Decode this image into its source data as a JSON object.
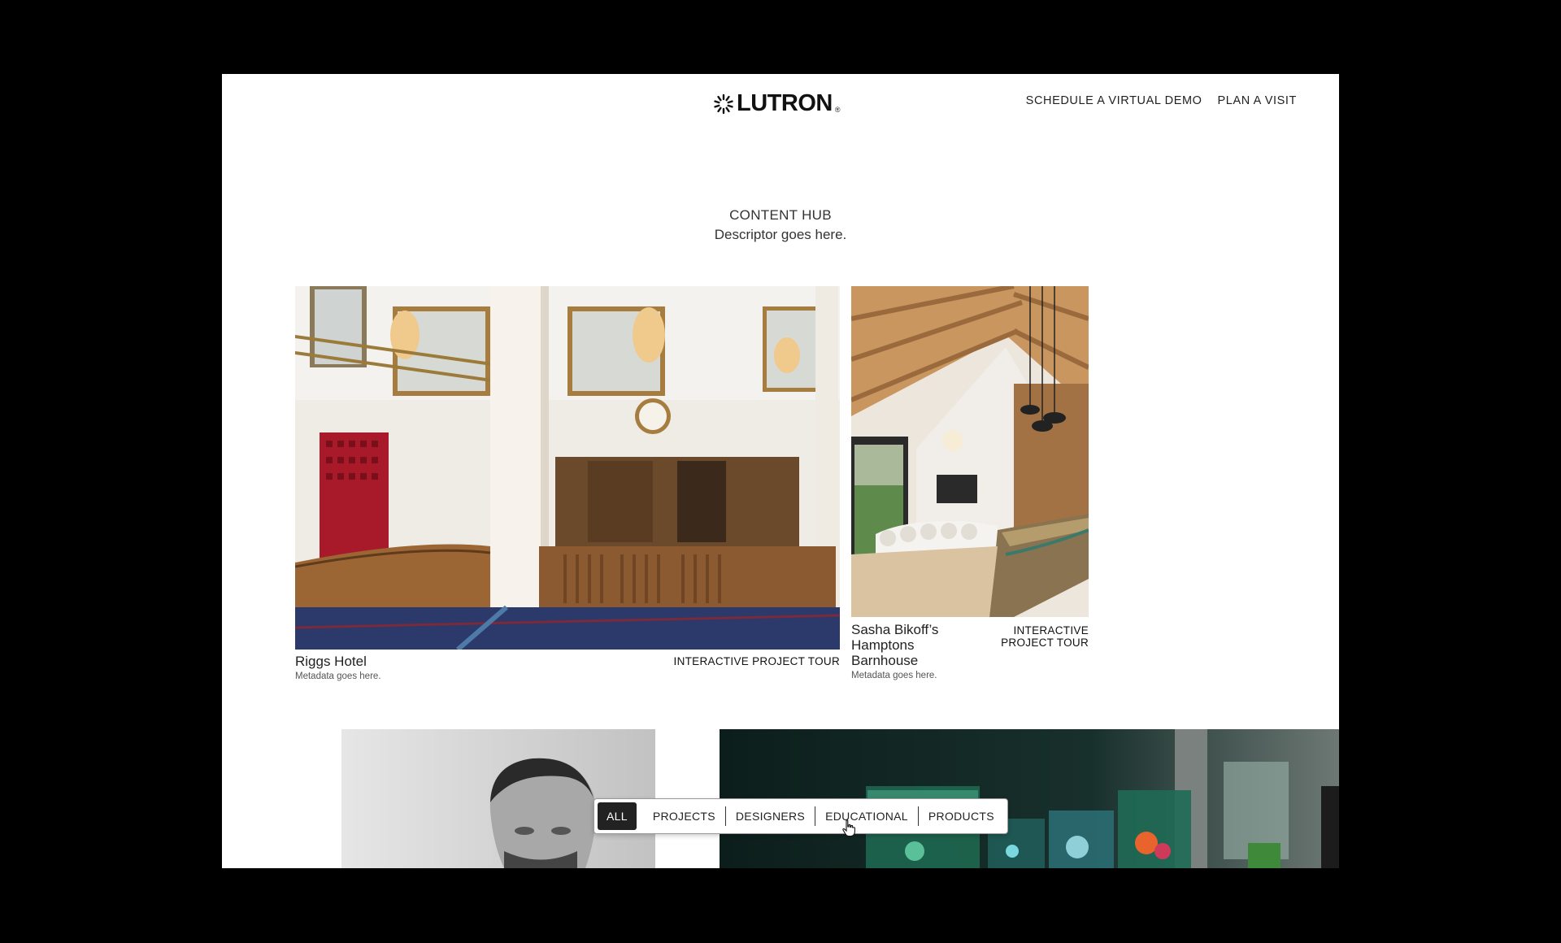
{
  "brand": {
    "name": "LUTRON",
    "reg_mark": "®"
  },
  "nav": {
    "items": [
      "SCHEDULE A VIRTUAL DEMO",
      "PLAN A VISIT"
    ]
  },
  "hero": {
    "title": "CONTENT HUB",
    "descriptor": "Descriptor goes here."
  },
  "cards": [
    {
      "title": "Riggs Hotel",
      "meta": "Metadata goes here.",
      "badge": "INTERACTIVE PROJECT TOUR",
      "image": "hotel-lobby-photo"
    },
    {
      "title_lines": [
        "Sasha Bikoff’s",
        "Hamptons",
        "Barnhouse"
      ],
      "meta": "Metadata goes here.",
      "badge_lines": [
        "INTERACTIVE",
        "PROJECT TOUR"
      ],
      "image": "barnhouse-living-room-photo"
    },
    {
      "image": "designer-portrait-photo"
    },
    {
      "image": "aquarium-art-photo"
    }
  ],
  "filters": {
    "items": [
      "ALL",
      "PROJECTS",
      "DESIGNERS",
      "EDUCATIONAL",
      "PRODUCTS"
    ],
    "active": "ALL"
  },
  "colors": {
    "background": "#000000",
    "page": "#ffffff",
    "active_filter": "#222222"
  }
}
